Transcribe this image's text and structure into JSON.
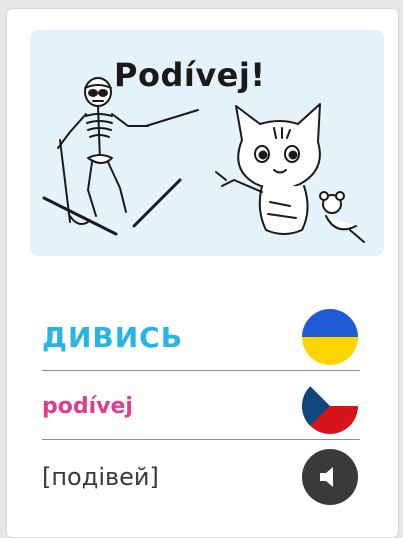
{
  "illustration": {
    "title": "Podívej!"
  },
  "rows": {
    "ukrainian": {
      "word": "ДИВИСЬ",
      "flag_icon": "ukraine-flag-icon",
      "flag_colors": [
        "#1f5bd6",
        "#ffd500"
      ]
    },
    "czech": {
      "word": "podívej",
      "flag_icon": "czech-flag-icon",
      "flag_colors": [
        "#ffffff",
        "#d7141a",
        "#11457e"
      ]
    },
    "transcription": {
      "word": "[подівей]",
      "sound_icon": "speaker-icon"
    }
  },
  "colors": {
    "ukrainian_text": "#29b5e4",
    "czech_text": "#e03c8a",
    "transcription_text": "#3a3a3a",
    "illustration_bg": "#e6f2fa"
  }
}
